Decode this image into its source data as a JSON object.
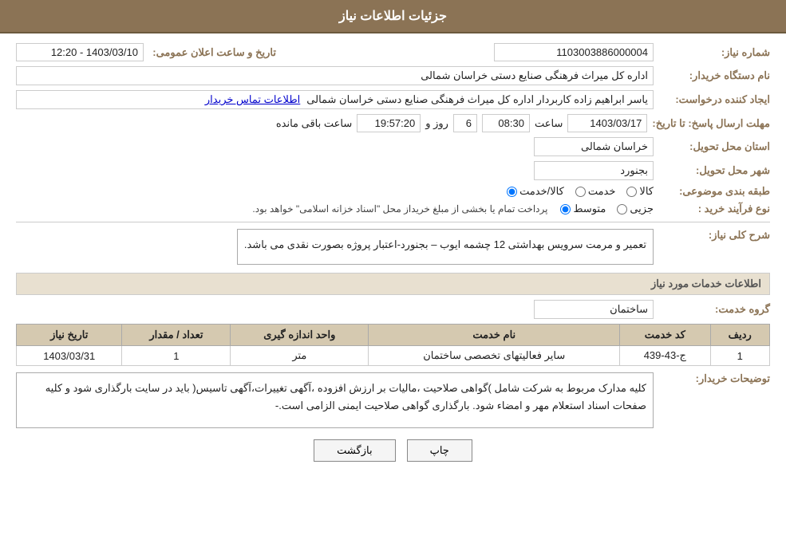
{
  "header": {
    "title": "جزئیات اطلاعات نیاز"
  },
  "fields": {
    "shomare_niaz_label": "شماره نیاز:",
    "shomare_niaz_value": "1103003886000004",
    "nam_dastgah_label": "نام دستگاه خریدار:",
    "nam_dastgah_value": "اداره کل میراث فرهنگی صنایع دستی خراسان شمالی",
    "ejad_konande_label": "ایجاد کننده درخواست:",
    "ejad_konande_value": "یاسر ابراهیم زاده کاربردار اداره کل میراث فرهنگی صنایع دستی خراسان شمالی",
    "ettelaat_tamas_label": "اطلاعات تماس خریدار",
    "tarikh_label": "تاریخ و ساعت اعلان عمومی:",
    "tarikh_value": "1403/03/10 - 12:20",
    "mohlat_label": "مهلت ارسال پاسخ: تا تاریخ:",
    "mohlat_date": "1403/03/17",
    "mohlat_saat_label": "ساعت",
    "mohlat_saat": "08:30",
    "mohlat_rooz_label": "روز و",
    "mohlat_rooz": "6",
    "mohlat_baqi_label": "ساعت باقی مانده",
    "mohlat_baqi": "19:57:20",
    "ostan_label": "استان محل تحویل:",
    "ostan_value": "خراسان شمالی",
    "shahr_label": "شهر محل تحویل:",
    "shahr_value": "بجنورد",
    "tabaqe_label": "طبقه بندی موضوعی:",
    "tabaqe_kala": "کالا",
    "tabaqe_khadamat": "خدمت",
    "tabaqe_kala_khadamat": "کالا/خدمت",
    "noetype_label": "نوع فرآیند خرید :",
    "noetype_jozi": "جزیی",
    "noetype_mottavaset": "متوسط",
    "noetype_desc": "پرداخت تمام یا بخشی از مبلغ خریداز محل \"اسناد خزانه اسلامی\" خواهد بود.",
    "sharh_label": "شرح کلی نیاز:",
    "sharh_value": "تعمیر و مرمت سرویس بهداشتی 12 چشمه ایوب – بجنورد-اعتبار پروژه بصورت نقدی می باشد.",
    "khadamat_title": "اطلاعات خدمات مورد نیاز",
    "gorohe_khadamat_label": "گروه خدمت:",
    "gorohe_khadamat_value": "ساختمان",
    "table": {
      "headers": [
        "ردیف",
        "کد خدمت",
        "نام خدمت",
        "واحد اندازه گیری",
        "تعداد / مقدار",
        "تاریخ نیاز"
      ],
      "rows": [
        {
          "radif": "1",
          "kod": "ج-43-439",
          "nam": "سایر فعالیتهای تخصصی ساختمان",
          "vahed": "متر",
          "tedad": "1",
          "tarikh": "1403/03/31"
        }
      ]
    },
    "tawzihat_label": "توضیحات خریدار:",
    "tawzihat_value": "کلیه مدارک مربوط به شرکت شامل )گواهی صلاحیت ،مالیات بر ارزش افزوده ،آگهی تغییرات،آگهی تاسیس( باید در سایت بارگذاری شود و کلیه صفحات اسناد استعلام مهر و امضاء شود. بارگذاری گواهی صلاحیت ایمنی الزامی است.-"
  },
  "buttons": {
    "print": "چاپ",
    "back": "بازگشت"
  }
}
